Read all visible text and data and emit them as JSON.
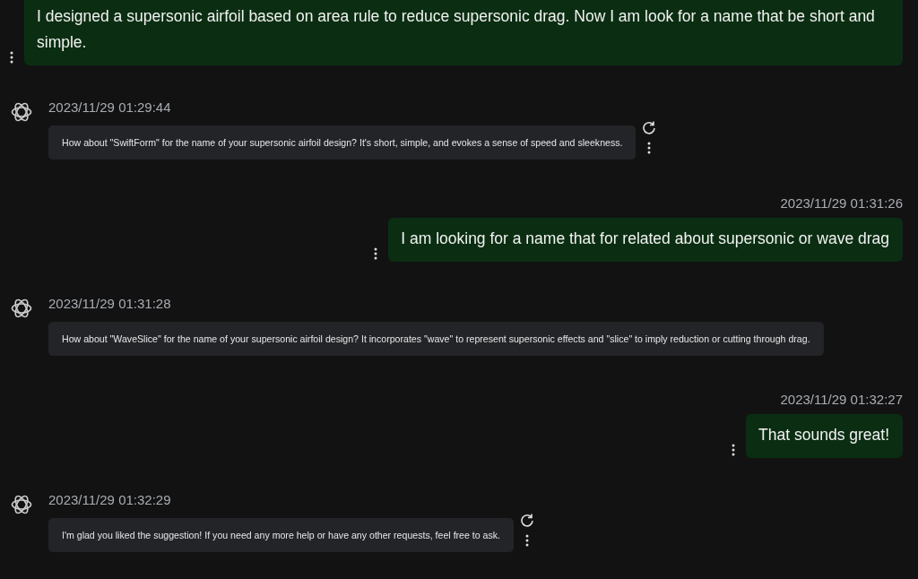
{
  "messages": [
    {
      "kind": "user",
      "text": "I designed a supersonic airfoil based on area rule to reduce supersonic drag. Now I am look for a name that be short and simple."
    },
    {
      "kind": "assistant",
      "time": "2023/11/29 01:29:44",
      "text": "How about \"SwiftForm\" for the name of your supersonic airfoil design? It's short, simple, and evokes a sense of speed and sleekness.",
      "show_actions": true
    },
    {
      "kind": "user",
      "time": "2023/11/29 01:31:26",
      "text": "I am looking for a name that for related about supersonic or wave drag"
    },
    {
      "kind": "assistant",
      "time": "2023/11/29 01:31:28",
      "text": "How about \"WaveSlice\" for the name of your supersonic airfoil design? It incorporates \"wave\" to represent supersonic effects and \"slice\" to imply reduction or cutting through drag.",
      "show_actions": false
    },
    {
      "kind": "user",
      "time": "2023/11/29 01:32:27",
      "text": "That sounds great!"
    },
    {
      "kind": "assistant",
      "time": "2023/11/29 01:32:29",
      "text": "I'm glad you liked the suggestion! If you need any more help or have any other requests, feel free to ask.",
      "show_actions": true
    }
  ]
}
